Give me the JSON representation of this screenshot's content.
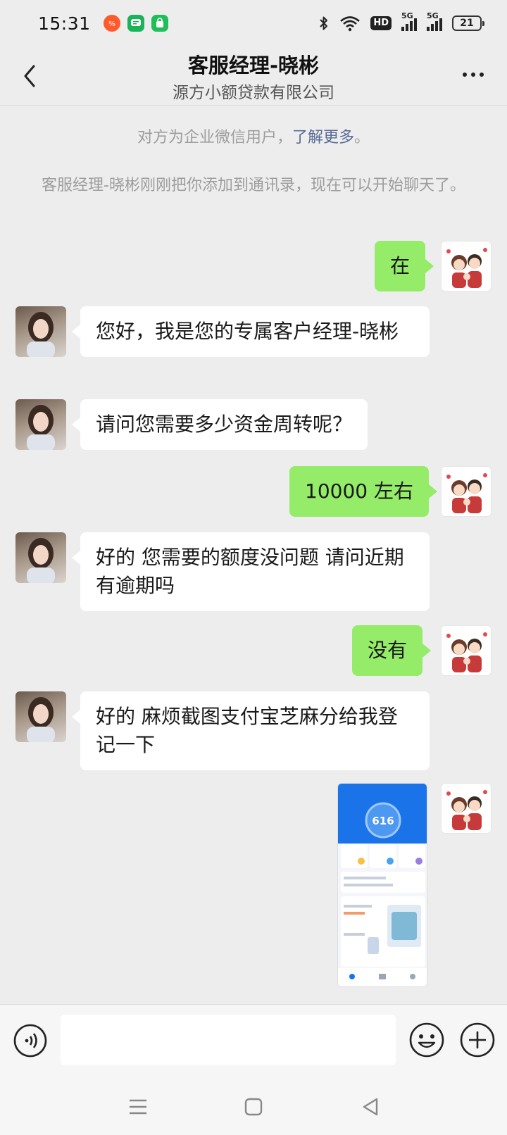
{
  "status_bar": {
    "time": "15:31",
    "battery": "21",
    "hd_label": "HD",
    "network_label": "5G"
  },
  "header": {
    "title": "客服经理-晓彬",
    "subtitle": "源方小额贷款有限公司"
  },
  "system_notes": {
    "enterprise_text": "对方为企业微信用户，",
    "learn_more": "了解更多",
    "enterprise_tail": "。",
    "added_text": "客服经理-晓彬刚刚把你添加到通讯录，现在可以开始聊天了。"
  },
  "messages": [
    {
      "from": "self",
      "text": "在"
    },
    {
      "from": "peer",
      "text": "您好，我是您的专属客户经理-晓彬"
    },
    {
      "from": "peer",
      "text": "请问您需要多少资金周转呢？"
    },
    {
      "from": "self",
      "text": "10000 左右"
    },
    {
      "from": "peer",
      "text": "好的 您需要的额度没问题  请问近期有逾期吗"
    },
    {
      "from": "self",
      "text": "没有"
    },
    {
      "from": "peer",
      "text": "好的 麻烦截图支付宝芝麻分给我登记一下"
    }
  ],
  "screenshot_message": {
    "score": "616"
  },
  "colors": {
    "chat_bg": "#ededed",
    "self_bubble": "#95ec69",
    "peer_bubble": "#ffffff",
    "link": "#576b95"
  }
}
